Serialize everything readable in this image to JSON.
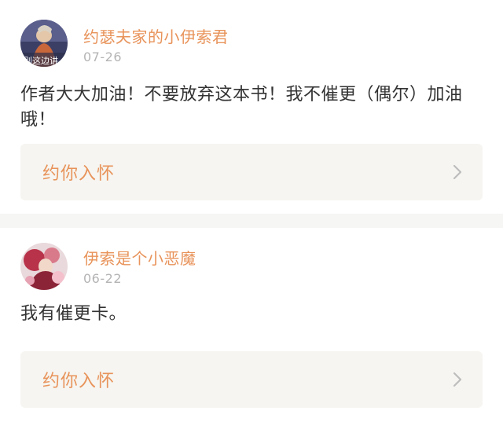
{
  "comments": [
    {
      "username": "约瑟夫家的小伊索君",
      "avatar_caption": "别这边讲",
      "date": "07-26",
      "text": "作者大大加油！不要放弃这本书！我不催更（偶尔）加油哦！",
      "book_title": "约你入怀"
    },
    {
      "username": "伊索是个小恶魔",
      "date": "06-22",
      "text": "我有催更卡。",
      "book_title": "约你入怀"
    }
  ],
  "colors": {
    "accent": "#e8935a",
    "date": "#b4b4b4",
    "text": "#333333",
    "book_bg": "#f6f5f1",
    "separator": "#f6f6f4"
  },
  "icons": {
    "book_link": "chevron-right-icon"
  }
}
